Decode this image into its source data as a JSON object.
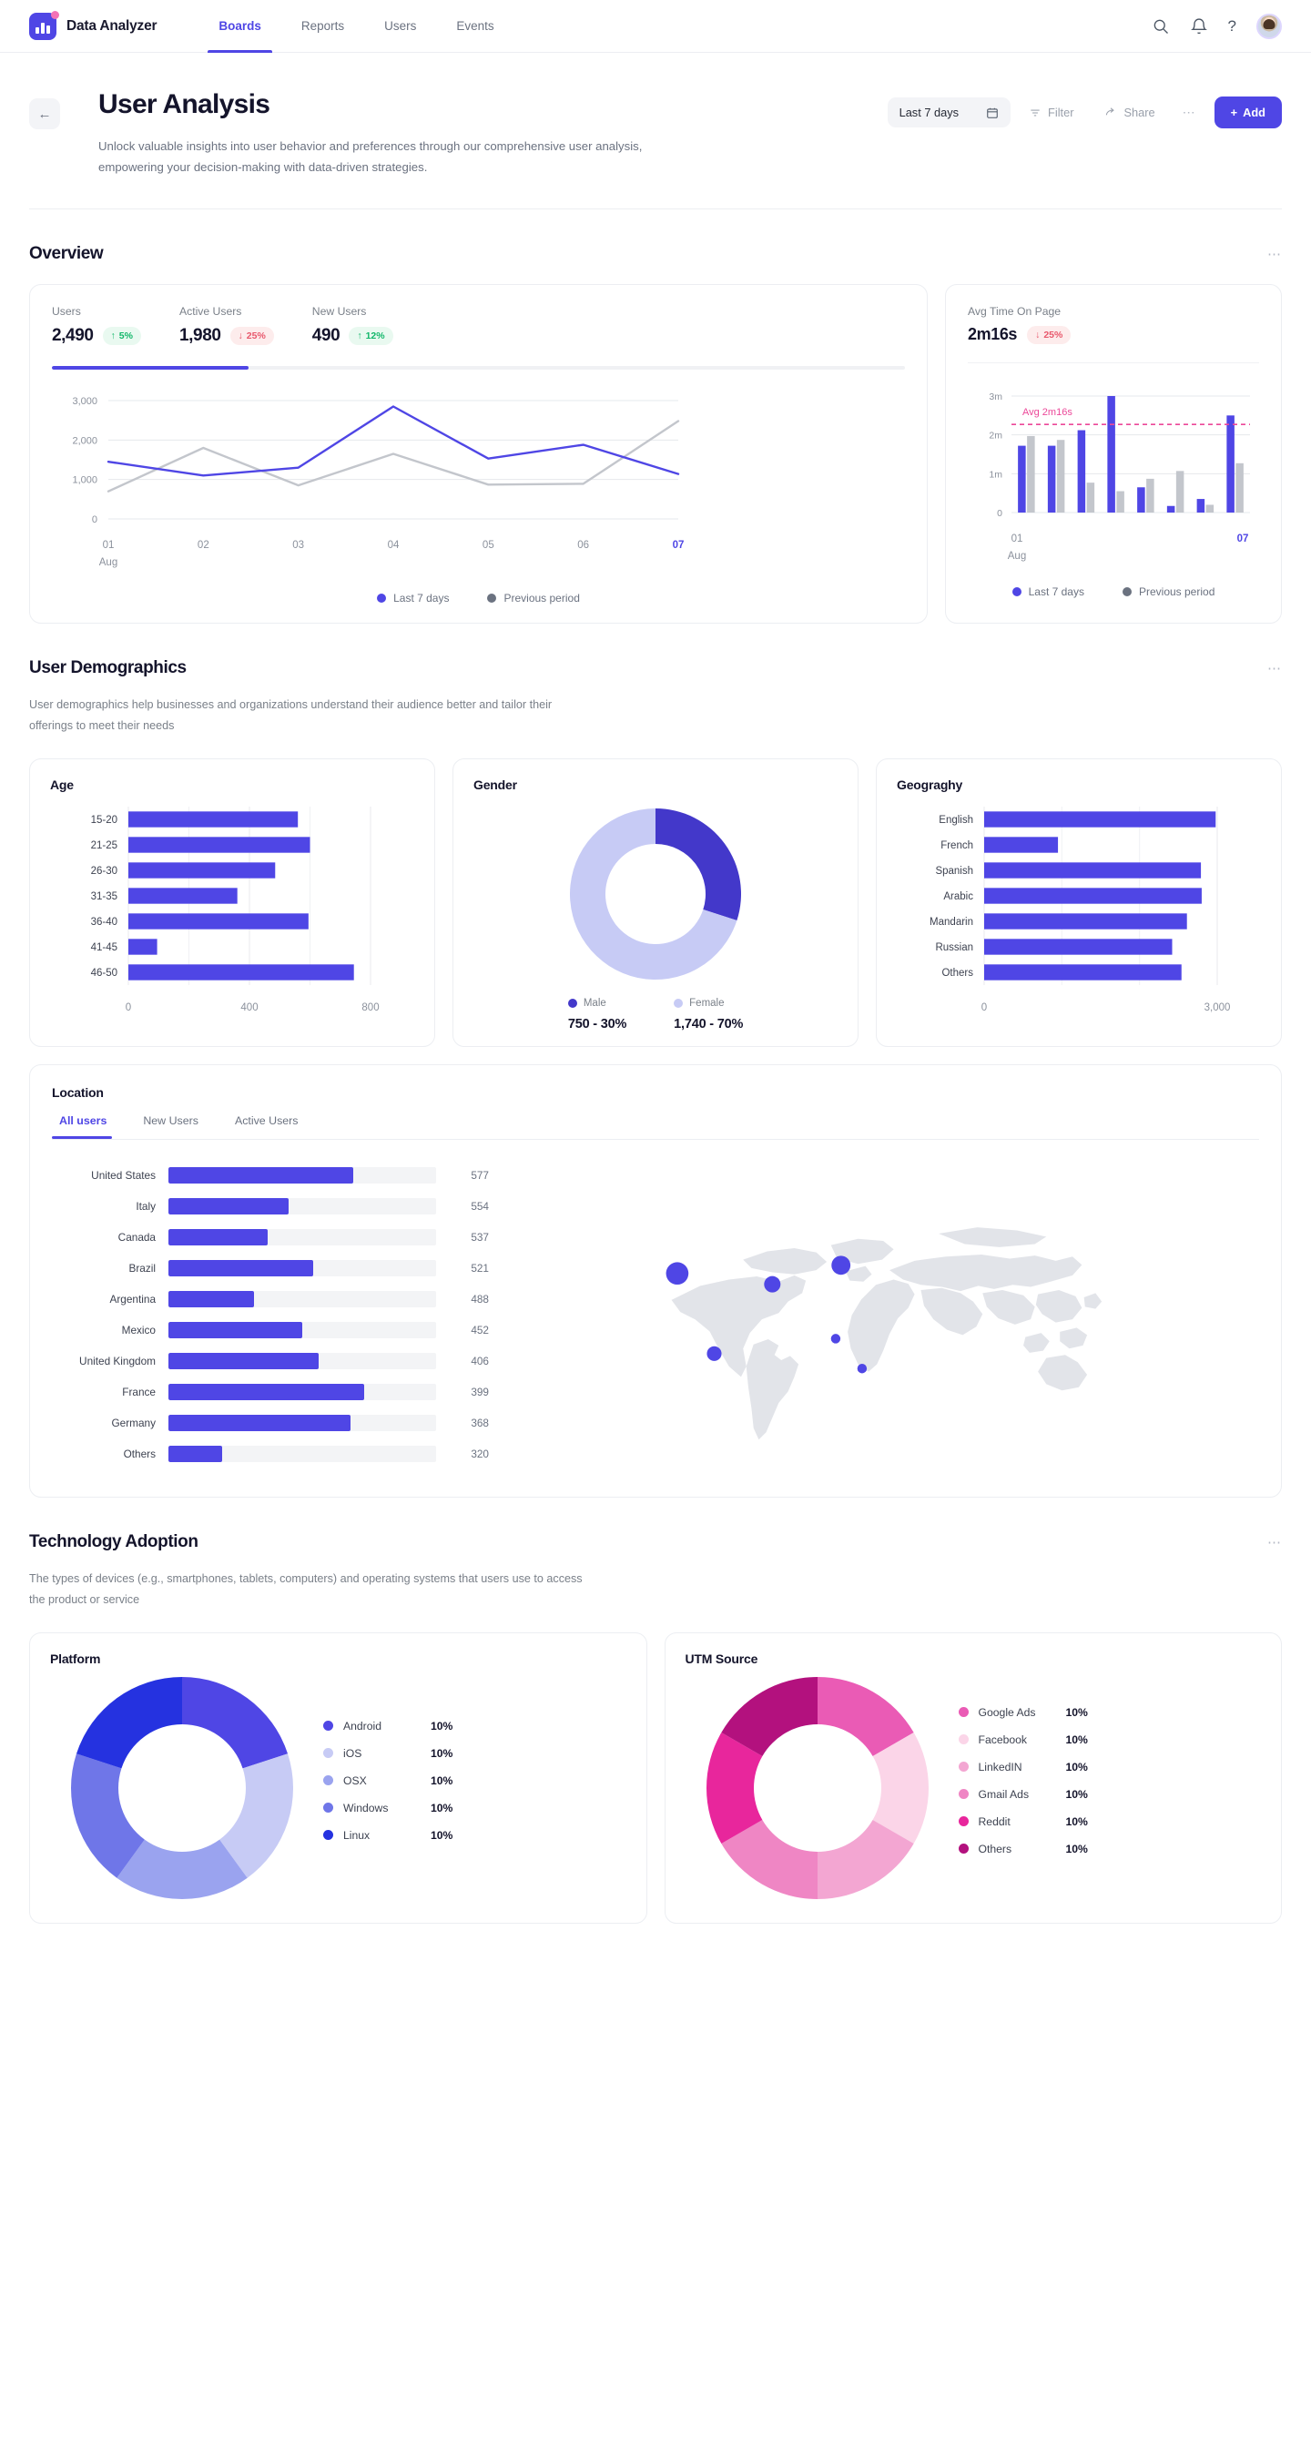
{
  "nav": {
    "brand": "Data Analyzer",
    "tabs": [
      {
        "label": "Boards",
        "active": true
      },
      {
        "label": "Reports",
        "active": false
      },
      {
        "label": "Users",
        "active": false
      },
      {
        "label": "Events",
        "active": false
      }
    ],
    "icons": [
      "search-icon",
      "bell-icon",
      "help-icon"
    ],
    "help_glyph": "?"
  },
  "header": {
    "back": "←",
    "title": "User Analysis",
    "description": "Unlock valuable insights into user behavior and preferences through our comprehensive user analysis, empowering your decision-making with data-driven strategies.",
    "date_range": "Last 7 days",
    "filter_label": "Filter",
    "share_label": "Share",
    "more_label": "⋯",
    "add_label": "Add"
  },
  "overview": {
    "title": "Overview",
    "more": "⋯",
    "kpis": [
      {
        "label": "Users",
        "value": "2,490",
        "change": "5%",
        "direction": "up",
        "arrow": "↑"
      },
      {
        "label": "Active Users",
        "value": "1,980",
        "change": "25%",
        "direction": "down",
        "arrow": "↓"
      },
      {
        "label": "New Users",
        "value": "490",
        "change": "12%",
        "direction": "up",
        "arrow": "↑"
      }
    ],
    "progress_pct": 23,
    "avg_time": {
      "label": "Avg Time On Page",
      "value": "2m16s",
      "change": "25%",
      "direction": "down",
      "arrow": "↓"
    },
    "legend": [
      {
        "label": "Last 7 days",
        "color": "#4f46e5"
      },
      {
        "label": "Previous period",
        "color": "#6b7280"
      }
    ]
  },
  "demographics": {
    "title": "User Demographics",
    "more": "⋯",
    "description": "User demographics help businesses and organizations understand their audience better and tailor their offerings to meet their needs",
    "age_title": "Age",
    "gender_title": "Gender",
    "geography_title": "Geograghy",
    "gender_legend": [
      {
        "label": "Male",
        "value": "750 - 30%",
        "color": "#4338ca"
      },
      {
        "label": "Female",
        "value": "1,740 - 70%",
        "color": "#c7cbf5"
      }
    ]
  },
  "location": {
    "title": "Location",
    "tabs": [
      {
        "label": "All users",
        "active": true
      },
      {
        "label": "New Users",
        "active": false
      },
      {
        "label": "Active Users",
        "active": false
      }
    ]
  },
  "technology": {
    "title": "Technology Adoption",
    "more": "⋯",
    "description": "The types of devices (e.g., smartphones, tablets, computers) and operating systems that users use to access the product or service",
    "platform_title": "Platform",
    "utm_title": "UTM Source"
  },
  "chart_data": [
    {
      "id": "overview_line",
      "type": "line",
      "title": "Overview users trend",
      "x": [
        "01",
        "02",
        "03",
        "04",
        "05",
        "06",
        "07"
      ],
      "xlabel": "Aug",
      "ylabel": "",
      "ylim": [
        0,
        3000
      ],
      "yticks": [
        0,
        1000,
        2000,
        3000
      ],
      "ytick_labels": [
        "0",
        "1,000",
        "2,000",
        "3,000"
      ],
      "grid": true,
      "legend_position": "bottom",
      "highlight_tick": "07",
      "series": [
        {
          "name": "Last 7 days",
          "color": "#4f46e5",
          "values": [
            1450,
            1100,
            1300,
            2850,
            1530,
            1880,
            1140
          ]
        },
        {
          "name": "Previous period",
          "color": "#c3c6cc",
          "values": [
            700,
            1800,
            850,
            1650,
            870,
            890,
            2480
          ]
        }
      ]
    },
    {
      "id": "avg_time_bars",
      "type": "bar",
      "title": "Avg Time On Page",
      "x": [
        "01",
        "02",
        "03",
        "04",
        "05",
        "06",
        "07"
      ],
      "xlabel": "Aug",
      "ylim": [
        0,
        3
      ],
      "yticks": [
        0,
        1,
        2,
        3
      ],
      "ytick_labels": [
        "0",
        "1m",
        "2m",
        "3m"
      ],
      "grid": true,
      "legend_position": "bottom",
      "highlight_tick": "07",
      "average_line": {
        "label": "Avg 2m16s",
        "value": 2.27,
        "color": "#ec4899"
      },
      "series": [
        {
          "name": "Last 7 days",
          "color": "#4f46e5",
          "values": [
            1.72,
            1.72,
            2.12,
            3.0,
            0.65,
            0.17,
            0.35,
            2.5
          ]
        },
        {
          "name": "Previous period",
          "color": "#c3c6cc",
          "values": [
            1.97,
            1.87,
            0.77,
            0.55,
            0.87,
            1.07,
            0.2,
            1.27
          ]
        }
      ]
    },
    {
      "id": "age_bars",
      "type": "bar",
      "orientation": "horizontal",
      "title": "Age",
      "categories": [
        "15-20",
        "21-25",
        "26-30",
        "31-35",
        "36-40",
        "41-45",
        "46-50"
      ],
      "values": [
        560,
        600,
        485,
        360,
        595,
        95,
        745
      ],
      "xlim": [
        0,
        800
      ],
      "xticks": [
        0,
        400,
        800
      ],
      "xtick_labels": [
        "0",
        "400",
        "800"
      ],
      "color": "#4f46e5",
      "grid": true
    },
    {
      "id": "gender_donut",
      "type": "pie",
      "title": "Gender",
      "labels": [
        "Male",
        "Female"
      ],
      "values": [
        30,
        70
      ],
      "value_labels": [
        "750 - 30%",
        "1,740 - 70%"
      ],
      "counts": [
        750,
        1740
      ],
      "colors": [
        "#4338ca",
        "#c7cbf5"
      ],
      "legend_position": "bottom"
    },
    {
      "id": "geography_bars",
      "type": "bar",
      "orientation": "horizontal",
      "title": "Geograghy",
      "categories": [
        "English",
        "French",
        "Spanish",
        "Arabic",
        "Mandarin",
        "Russian",
        "Others"
      ],
      "values": [
        2980,
        950,
        2790,
        2800,
        2610,
        2420,
        2540
      ],
      "xlim": [
        0,
        3000
      ],
      "xticks": [
        0,
        3000
      ],
      "xtick_labels": [
        "0",
        "3,000"
      ],
      "color": "#4f46e5",
      "grid": true
    },
    {
      "id": "location_bars",
      "type": "bar",
      "orientation": "horizontal",
      "title": "Location",
      "categories": [
        "United States",
        "Italy",
        "Canada",
        "Brazil",
        "Argentina",
        "Mexico",
        "United Kingdom",
        "France",
        "Germany",
        "Others"
      ],
      "values": [
        577,
        554,
        537,
        521,
        488,
        452,
        406,
        399,
        368,
        320
      ],
      "bar_pct": [
        69,
        45,
        37,
        54,
        32,
        50,
        56,
        73,
        68,
        20
      ],
      "color": "#4f46e5",
      "track_color": "#f3f4f6"
    },
    {
      "id": "location_map",
      "type": "scatter",
      "title": "Location map",
      "points": [
        {
          "name": "United States",
          "x": 10.5,
          "y": 33.5,
          "r": 13
        },
        {
          "name": "Mexico",
          "x": 17.5,
          "y": 63.0,
          "r": 8.5
        },
        {
          "name": "United Kingdom",
          "x": 28.5,
          "y": 37.5,
          "r": 9.5
        },
        {
          "name": "Russia",
          "x": 41.5,
          "y": 30.5,
          "r": 11
        },
        {
          "name": "India",
          "x": 40.5,
          "y": 57.5,
          "r": 5.5
        },
        {
          "name": "Indonesia",
          "x": 45.5,
          "y": 68.5,
          "r": 5.5
        }
      ],
      "point_color": "#4f46e5",
      "land_color": "#e2e4e9"
    },
    {
      "id": "platform_donut",
      "type": "pie",
      "title": "Platform",
      "labels": [
        "Android",
        "iOS",
        "OSX",
        "Windows",
        "Linux"
      ],
      "values": [
        10,
        10,
        10,
        10,
        10
      ],
      "value_labels": [
        "10%",
        "10%",
        "10%",
        "10%",
        "10%"
      ],
      "colors": [
        "#4f46e5",
        "#c7cbf5",
        "#9aa3ef",
        "#6f76e8",
        "#2532e0"
      ],
      "legend_position": "right"
    },
    {
      "id": "utm_donut",
      "type": "pie",
      "title": "UTM Source",
      "labels": [
        "Google Ads",
        "Facebook",
        "LinkedIN",
        "Gmail Ads",
        "Reddit",
        "Others"
      ],
      "values": [
        10,
        10,
        10,
        10,
        10,
        10
      ],
      "value_labels": [
        "10%",
        "10%",
        "10%",
        "10%",
        "10%",
        "10%"
      ],
      "colors": [
        "#ea5bb5",
        "#fbd5e8",
        "#f3a6d2",
        "#ef86c4",
        "#e8269c",
        "#b3117e"
      ],
      "legend_position": "right"
    }
  ]
}
